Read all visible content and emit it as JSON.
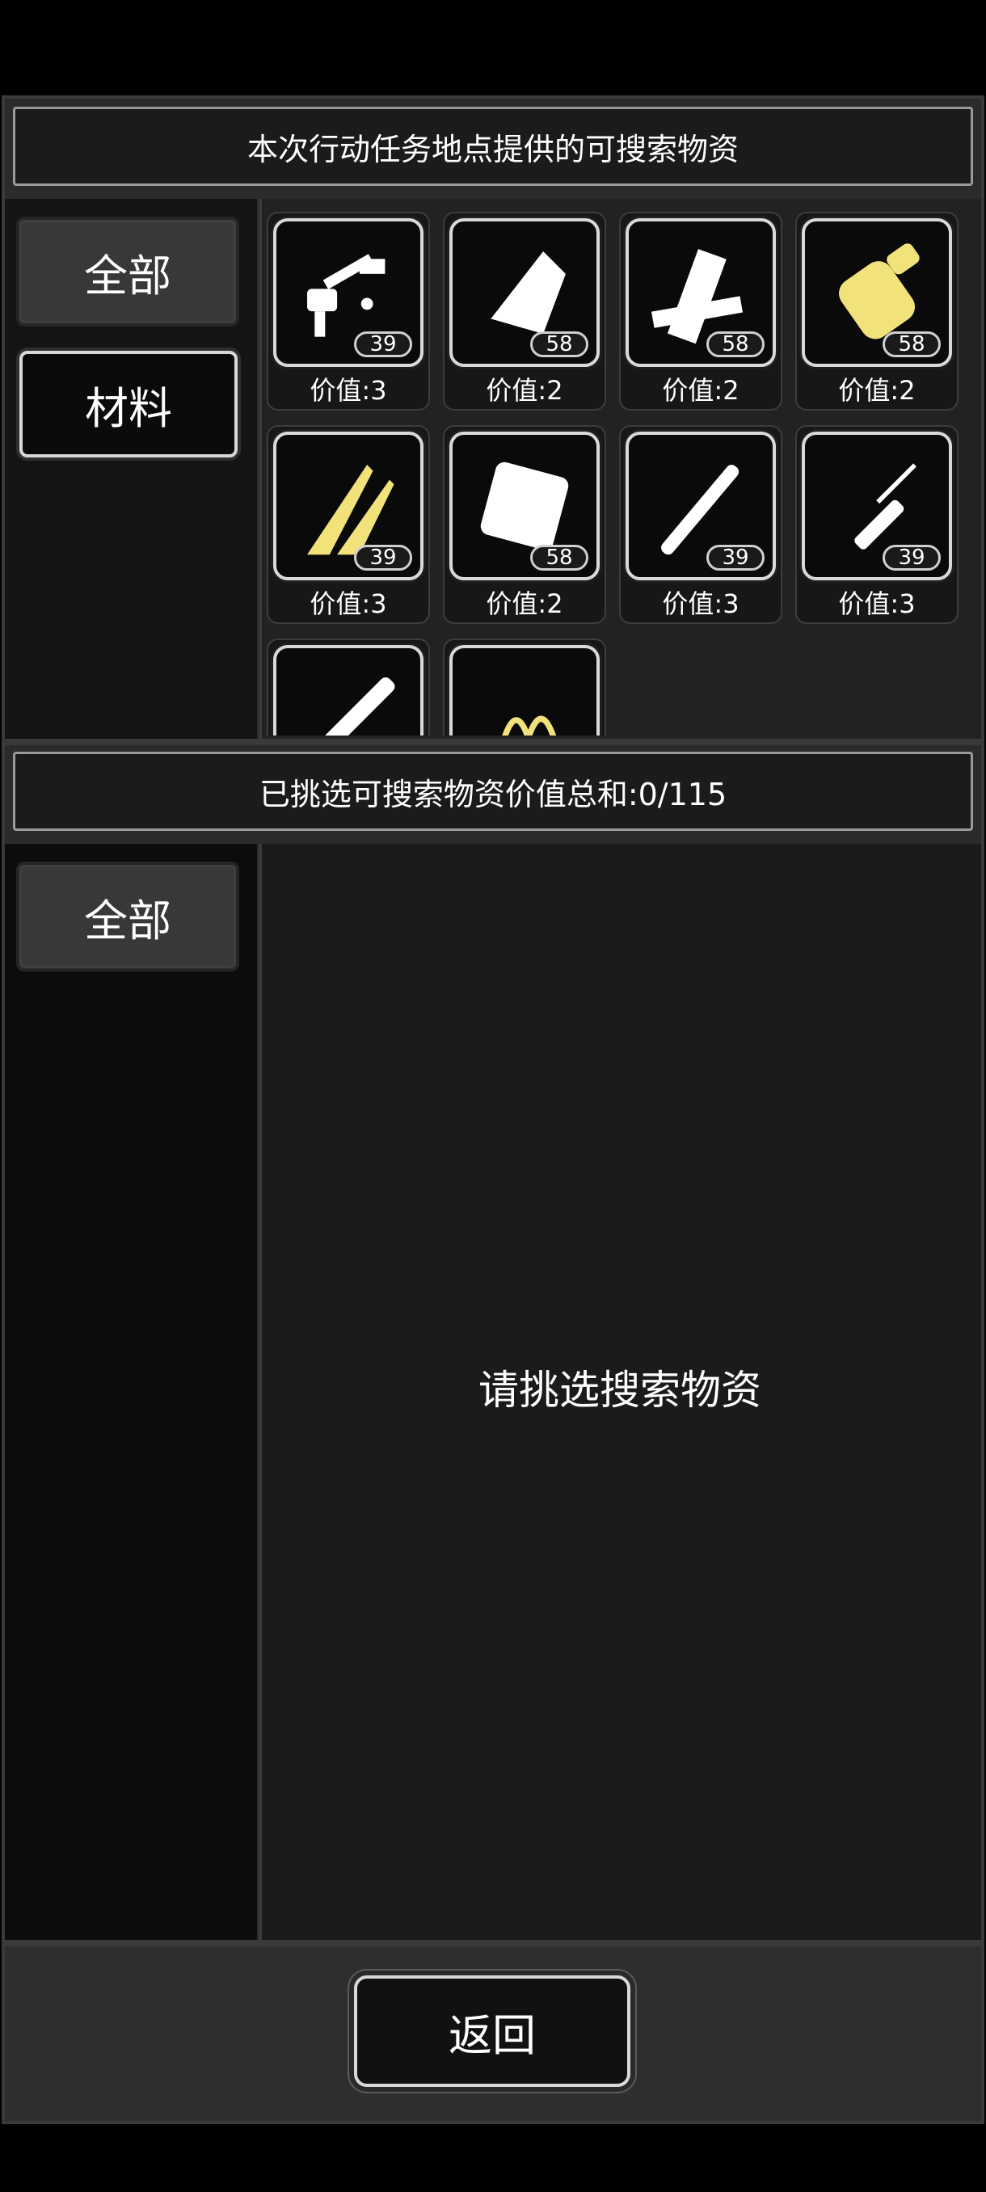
{
  "top_section": {
    "title": "本次行动任务地点提供的可搜索物资",
    "tabs": [
      {
        "label": "全部",
        "active": true
      },
      {
        "label": "材料",
        "active": false
      }
    ],
    "items": [
      {
        "icon": "weapon-parts-icon",
        "count": "39",
        "value": "价值:3",
        "tint": "#ffffff"
      },
      {
        "icon": "cloth-icon",
        "count": "58",
        "value": "价值:2",
        "tint": "#ffffff"
      },
      {
        "icon": "wood-planks-icon",
        "count": "58",
        "value": "价值:2",
        "tint": "#ffffff"
      },
      {
        "icon": "battery-icon",
        "count": "58",
        "value": "价值:2",
        "tint": "#f2e27a"
      },
      {
        "icon": "blades-icon",
        "count": "39",
        "value": "价值:3",
        "tint": "#f2e27a"
      },
      {
        "icon": "bag-icon",
        "count": "58",
        "value": "价值:2",
        "tint": "#ffffff"
      },
      {
        "icon": "pipe-icon",
        "count": "39",
        "value": "价值:3",
        "tint": "#ffffff"
      },
      {
        "icon": "screwdriver-icon",
        "count": "39",
        "value": "价值:3",
        "tint": "#ffffff"
      },
      {
        "icon": "pen-icon",
        "count": "",
        "value": "",
        "tint": "#ffffff"
      },
      {
        "icon": "wire-icon",
        "count": "",
        "value": "",
        "tint": "#f2e27a"
      }
    ]
  },
  "bottom_section": {
    "title": "已挑选可搜索物资价值总和:0/115",
    "tabs": [
      {
        "label": "全部",
        "active": true
      }
    ],
    "empty_message": "请挑选搜索物资"
  },
  "footer": {
    "back_label": "返回"
  }
}
